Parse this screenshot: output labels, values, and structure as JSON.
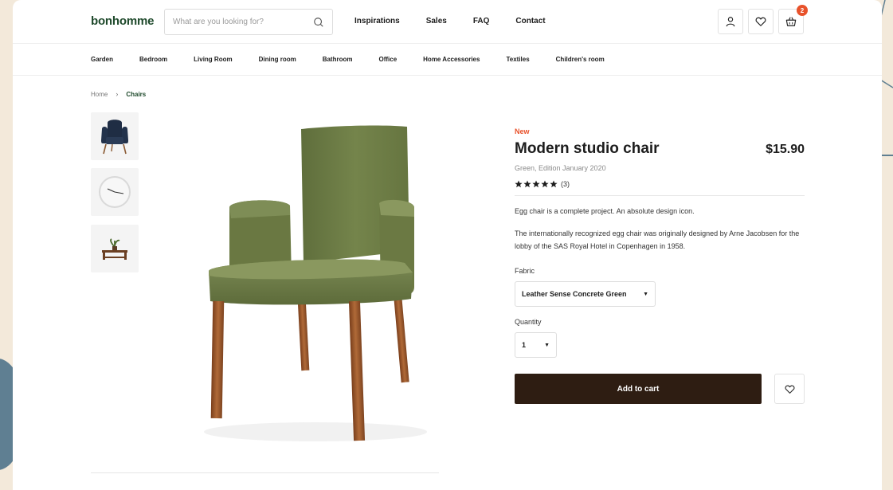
{
  "header": {
    "logo": "bonhomme",
    "search": {
      "placeholder": "What are you looking for?",
      "icon": "search-icon"
    },
    "nav": [
      "Inspirations",
      "Sales",
      "FAQ",
      "Contact"
    ],
    "icons": {
      "account": "user-icon",
      "wishlist": "heart-icon",
      "cart": "basket-icon"
    },
    "cart_count": "2"
  },
  "categories": [
    "Garden",
    "Bedroom",
    "Living Room",
    "Dining room",
    "Bathroom",
    "Office",
    "Home Accessories",
    "Textiles",
    "Children's room"
  ],
  "breadcrumb": {
    "home": "Home",
    "separator": "›",
    "current": "Chairs"
  },
  "thumbnails": [
    "navy-armchair-thumbnail",
    "wall-clock-thumbnail",
    "wooden-bench-thumbnail"
  ],
  "product": {
    "badge": "New",
    "title": "Modern studio chair",
    "price": "$15.90",
    "subtitle": "Green, Edition January 2020",
    "rating": 5,
    "rating_count": "(3)",
    "description_1": "Egg chair is a complete project. An absolute design icon.",
    "description_2": "The internationally recognized egg chair was originally designed by Arne Jacobsen for the lobby of the SAS Royal Hotel in Copenhagen in 1958.",
    "fabric_label": "Fabric",
    "fabric_value": "Leather Sense Concrete Green",
    "quantity_label": "Quantity",
    "quantity_value": "1",
    "add_to_cart": "Add to cart"
  },
  "colors": {
    "brand_green": "#1f4a2c",
    "accent_orange": "#e8522b",
    "button_dark": "#2e1d12",
    "page_bg": "#f3e9da",
    "chair_green": "#6b7b45",
    "chair_legs": "#9c5a2c"
  }
}
